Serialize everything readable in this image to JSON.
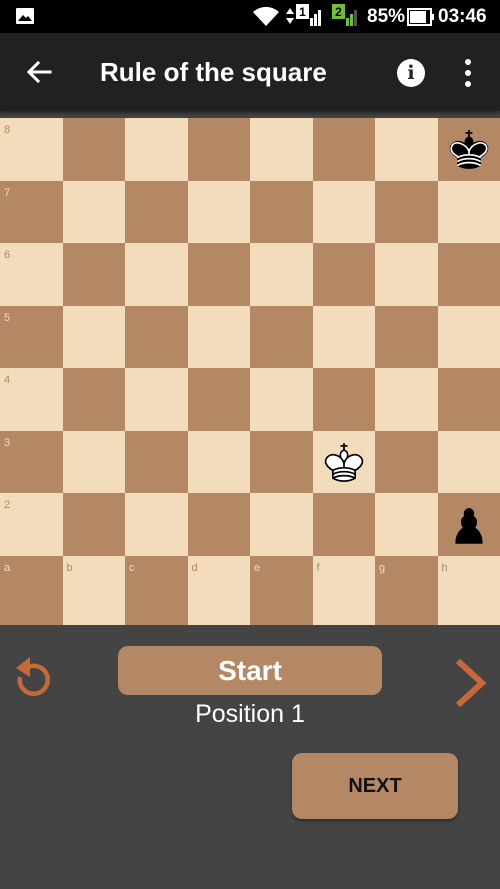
{
  "status_bar": {
    "sim1_badge": "1",
    "sim2_badge": "2",
    "battery_percent": "85%",
    "time": "03:46",
    "icons": [
      "gallery-icon",
      "wifi-icon",
      "signal-icon",
      "battery-icon"
    ]
  },
  "app_bar": {
    "title": "Rule of the square",
    "icons": [
      "back-arrow-icon",
      "info-icon",
      "more-vert-icon"
    ]
  },
  "board": {
    "colors": {
      "light": "#f2dcbc",
      "dark": "#b58865"
    },
    "rank_labels": [
      "8",
      "7",
      "6",
      "5",
      "4",
      "3",
      "2"
    ],
    "file_labels": [
      "a",
      "b",
      "c",
      "d",
      "e",
      "f",
      "g",
      "h"
    ],
    "pieces": [
      {
        "square": "h8",
        "piece": "black-king"
      },
      {
        "square": "f3",
        "piece": "white-king"
      },
      {
        "square": "h2",
        "piece": "black-pawn"
      }
    ]
  },
  "controls": {
    "start_label": "Start",
    "position_label": "Position 1",
    "next_label": "NEXT",
    "accent_color": "#c8693a",
    "icons": [
      "reset-icon",
      "chevron-right-icon"
    ]
  }
}
